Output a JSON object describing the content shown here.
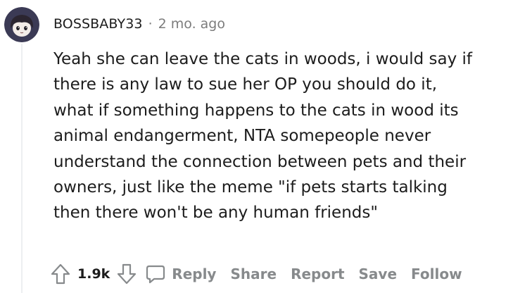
{
  "comment": {
    "username": "BOSSBABY33",
    "separator": "·",
    "time": "2 mo. ago",
    "lines": [
      "Yeah she can leave the cats in woods, i would say if",
      "there is any law to sue her OP you should do it,",
      "what if something happens to the cats in wood its",
      "animal endangerment, NTA somepeople never",
      "understand the connection between pets and their",
      "owners, just like the meme \"if pets starts talking",
      "then there won't be any human friends\""
    ],
    "score": "1.9k",
    "actions": {
      "reply": "Reply",
      "share": "Share",
      "report": "Report",
      "save": "Save",
      "follow": "Follow"
    }
  },
  "icons": {
    "upvote": "upvote-arrow-icon",
    "downvote": "downvote-arrow-icon",
    "reply": "comment-bubble-icon",
    "avatar": "anime-character-avatar"
  },
  "colors": {
    "text": "#1c1c1c",
    "meta": "#7c7c7c",
    "action": "#878a8c",
    "thread_line": "#edeff1",
    "avatar_bg": "#3b3a55"
  }
}
